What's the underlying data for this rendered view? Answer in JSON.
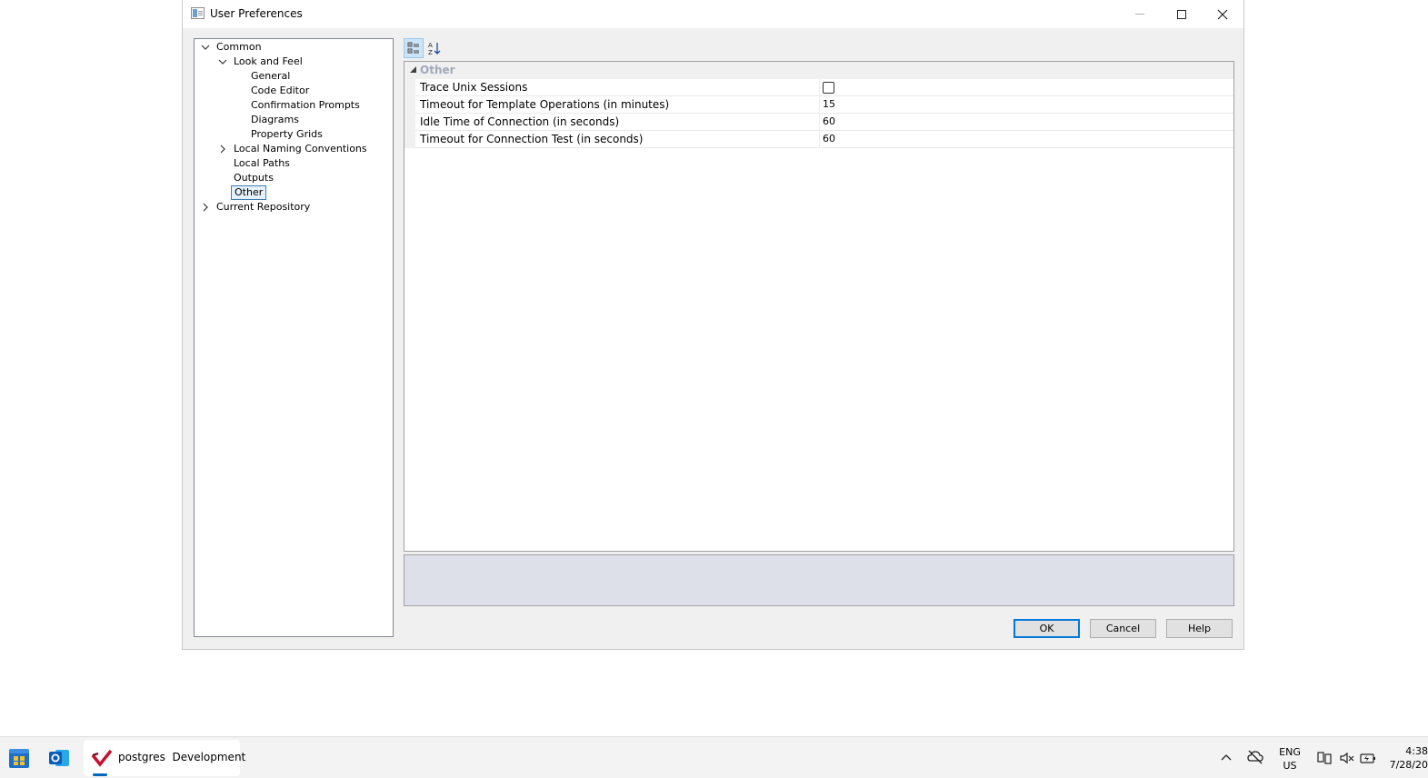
{
  "window": {
    "title": "User Preferences"
  },
  "tree": {
    "items": [
      {
        "label": "Common",
        "level": 0,
        "expander": "expanded"
      },
      {
        "label": "Look and Feel",
        "level": 1,
        "expander": "expanded"
      },
      {
        "label": "General",
        "level": 2,
        "expander": "none"
      },
      {
        "label": "Code Editor",
        "level": 2,
        "expander": "none"
      },
      {
        "label": "Confirmation Prompts",
        "level": 2,
        "expander": "none"
      },
      {
        "label": "Diagrams",
        "level": 2,
        "expander": "none"
      },
      {
        "label": "Property Grids",
        "level": 2,
        "expander": "none"
      },
      {
        "label": "Local Naming Conventions",
        "level": 1,
        "expander": "collapsed"
      },
      {
        "label": "Local Paths",
        "level": 1,
        "expander": "none"
      },
      {
        "label": "Outputs",
        "level": 1,
        "expander": "none"
      },
      {
        "label": "Other",
        "level": 1,
        "expander": "none",
        "selected": true
      },
      {
        "label": "Current Repository",
        "level": 0,
        "expander": "collapsed"
      }
    ]
  },
  "toolbar": {
    "categorized_icon": "categorized-view-icon",
    "alphabetical_icon": "sort-alphabetical-icon"
  },
  "grid": {
    "category": "Other",
    "properties": [
      {
        "name": "Trace Unix Sessions",
        "type": "checkbox",
        "checked": false
      },
      {
        "name": "Timeout for Template Operations (in minutes)",
        "type": "text",
        "value": "15"
      },
      {
        "name": "Idle Time of Connection (in seconds)",
        "type": "text",
        "value": "60"
      },
      {
        "name": "Timeout for Connection Test (in seconds)",
        "type": "text",
        "value": "60"
      }
    ]
  },
  "buttons": {
    "ok": "OK",
    "cancel": "Cancel",
    "help": "Help"
  },
  "taskbar": {
    "task_label": "postgres  Development",
    "lang_top": "ENG",
    "lang_bottom": "US",
    "time": "4:38",
    "date": "7/28/20"
  },
  "colors": {
    "accent": "#0078d7",
    "selection_border": "#3c7fb1",
    "category_text": "#a0a8b8",
    "description_bg": "#dde0e8"
  }
}
